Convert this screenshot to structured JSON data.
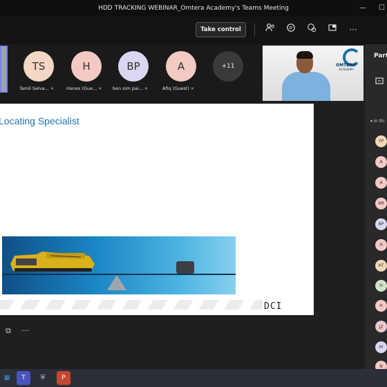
{
  "window": {
    "title": "HDD TRACKING WEBINAR_Omtera Academy's Teams Meeting"
  },
  "toolbar": {
    "take_control_label": "Take control",
    "more_label": "···"
  },
  "participants": [
    {
      "initials": "TS",
      "name": "Tamil Selva...",
      "color": "#f3d6c3"
    },
    {
      "initials": "H",
      "name": "Hanes (Gue...",
      "color": "#f3c9c4"
    },
    {
      "initials": "BP",
      "name": "ben sim pai...",
      "color": "#d9d7f2"
    },
    {
      "initials": "A",
      "name": "Afiq (Guest)",
      "color": "#f3c9c4"
    }
  ],
  "more_participants": "+11",
  "video": {
    "logo_text": "OMTERA",
    "logo_sub": "ACADEMY"
  },
  "side_panel": {
    "title": "Part",
    "section": "In thi",
    "avatars": [
      {
        "initials": "YP",
        "color": "#f0d8b5"
      },
      {
        "initials": "A",
        "color": "#f3c9c4"
      },
      {
        "initials": "A",
        "color": "#f3c9c4"
      },
      {
        "initials": "AR",
        "color": "#f3c9c4"
      },
      {
        "initials": "BP",
        "color": "#d9d7f2"
      },
      {
        "initials": "H",
        "color": "#f3c9c4"
      },
      {
        "initials": "HT",
        "color": "#f0d8b5"
      },
      {
        "initials": "H",
        "color": "#cfe5c7"
      },
      {
        "initials": "H",
        "color": "#f3c9c4"
      },
      {
        "initials": "JZ",
        "color": "#f3c9c4"
      },
      {
        "initials": "M",
        "color": "#d9d7f2"
      },
      {
        "initials": "N",
        "color": "#f3c9c4"
      }
    ]
  },
  "slide": {
    "title": "Locating Specialist",
    "brand": "DCI"
  }
}
